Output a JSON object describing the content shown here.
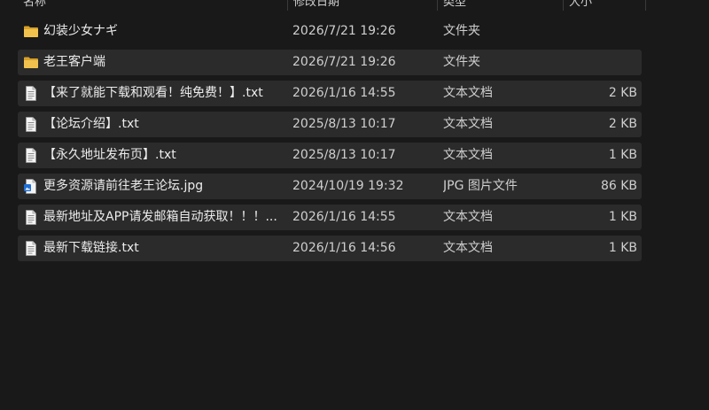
{
  "columns": {
    "name": "名称",
    "date": "修改日期",
    "type": "类型",
    "size": "大小"
  },
  "files": [
    {
      "name": "幻装少女ナギ",
      "date": "2026/7/21 19:26",
      "type": "文件夹",
      "size": "",
      "icon": "folder-icon"
    },
    {
      "name": "老王客户端",
      "date": "2026/7/21 19:26",
      "type": "文件夹",
      "size": "",
      "icon": "folder-icon"
    },
    {
      "name": "【来了就能下载和观看！纯免费！】.txt",
      "date": "2026/1/16 14:55",
      "type": "文本文档",
      "size": "2 KB",
      "icon": "text-file-icon"
    },
    {
      "name": "【论坛介绍】.txt",
      "date": "2025/8/13 10:17",
      "type": "文本文档",
      "size": "2 KB",
      "icon": "text-file-icon"
    },
    {
      "name": "【永久地址发布页】.txt",
      "date": "2025/8/13 10:17",
      "type": "文本文档",
      "size": "1 KB",
      "icon": "text-file-icon"
    },
    {
      "name": "更多资源请前往老王论坛.jpg",
      "date": "2024/10/19 19:32",
      "type": "JPG 图片文件",
      "size": "86 KB",
      "icon": "image-file-icon"
    },
    {
      "name": "最新地址及APP请发邮箱自动获取！！！...",
      "date": "2026/1/16 14:55",
      "type": "文本文档",
      "size": "1 KB",
      "icon": "text-file-icon"
    },
    {
      "name": "最新下载链接.txt",
      "date": "2026/1/16 14:56",
      "type": "文本文档",
      "size": "1 KB",
      "icon": "text-file-icon"
    }
  ],
  "colors": {
    "background": "#191919",
    "row_alt": "#2b2b2b",
    "folder": "#e8b53c",
    "text": "#ececec"
  }
}
